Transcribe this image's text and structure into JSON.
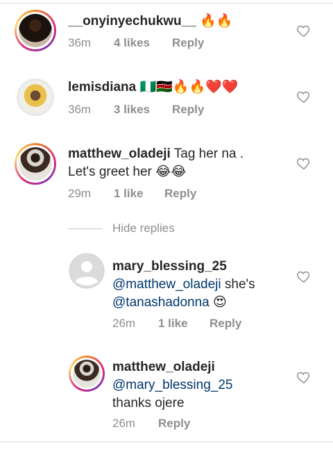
{
  "comments": [
    {
      "username": "__onyinyechukwu__",
      "text": "🔥🔥",
      "time": "36m",
      "likes": "4 likes",
      "reply": "Reply",
      "avatar": "woman-portrait"
    },
    {
      "username": "lemisdiana",
      "text": "🇳🇬🇰🇪🔥🔥❤️❤️",
      "time": "36m",
      "likes": "3 likes",
      "reply": "Reply",
      "avatar": "woman-yellow-braids"
    },
    {
      "username": "matthew_oladeji",
      "text_line1": "Tag her na .",
      "text_line2": "Let's greet her 😂😂",
      "time": "29m",
      "likes": "1 like",
      "reply": "Reply",
      "avatar": "man-portrait"
    }
  ],
  "hide_replies": "Hide replies",
  "replies": [
    {
      "username": "mary_blessing_25",
      "mention": "@matthew_oladeji",
      "text_after_mention": " she's",
      "mention2": "@tanashadonna",
      "emoji": "😍",
      "time": "26m",
      "likes": "1 like",
      "reply": "Reply",
      "avatar": "default-user"
    },
    {
      "username": "matthew_oladeji",
      "mention": "@mary_blessing_25",
      "text": "thanks ojere",
      "time": "26m",
      "reply": "Reply",
      "avatar": "man-portrait"
    }
  ],
  "icons": {
    "like": "heart-outline-icon"
  },
  "colors": {
    "mention": "#00376b",
    "meta": "#8e8e8e",
    "text": "#262626"
  }
}
